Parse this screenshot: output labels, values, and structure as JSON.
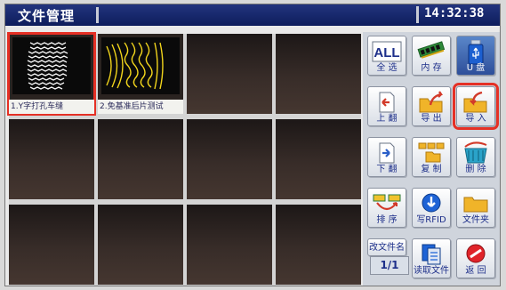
{
  "title": "文件管理",
  "clock": "14:32:38",
  "files": [
    {
      "name": "1.Y字打孔车缝",
      "thumb": "zigzag-rows",
      "selected": true
    },
    {
      "name": "2.免基准后片测试",
      "thumb": "arcs-yellow",
      "selected": false
    },
    {
      "name": "",
      "thumb": "",
      "selected": false
    },
    {
      "name": "",
      "thumb": "",
      "selected": false
    },
    {
      "name": "",
      "thumb": "",
      "selected": false
    },
    {
      "name": "",
      "thumb": "",
      "selected": false
    },
    {
      "name": "",
      "thumb": "",
      "selected": false
    },
    {
      "name": "",
      "thumb": "",
      "selected": false
    },
    {
      "name": "",
      "thumb": "",
      "selected": false
    },
    {
      "name": "",
      "thumb": "",
      "selected": false
    },
    {
      "name": "",
      "thumb": "",
      "selected": false
    },
    {
      "name": "",
      "thumb": "",
      "selected": false
    }
  ],
  "buttons": {
    "select_all": {
      "icon_text": "ALL",
      "label": "全 选"
    },
    "memory": {
      "label": "内 存"
    },
    "usb": {
      "label": "U 盘"
    },
    "page_up": {
      "label": "上 翻"
    },
    "export": {
      "label": "导 出"
    },
    "import": {
      "label": "导 入",
      "highlighted": true
    },
    "page_down": {
      "label": "下 翻"
    },
    "copy": {
      "label": "复 制"
    },
    "delete": {
      "label": "删 除"
    },
    "sort": {
      "label": "排 序"
    },
    "write_rfid": {
      "label": "写RFID"
    },
    "folder": {
      "label": "文件夹"
    },
    "rename": {
      "label": "改文件名"
    },
    "read_file": {
      "label": "读取文件"
    },
    "back": {
      "label": "返 回"
    }
  },
  "page_indicator": "1/1",
  "colors": {
    "title_bar": "#0d1c5c",
    "selection": "#e53025",
    "button_text": "#1d2f8a"
  }
}
